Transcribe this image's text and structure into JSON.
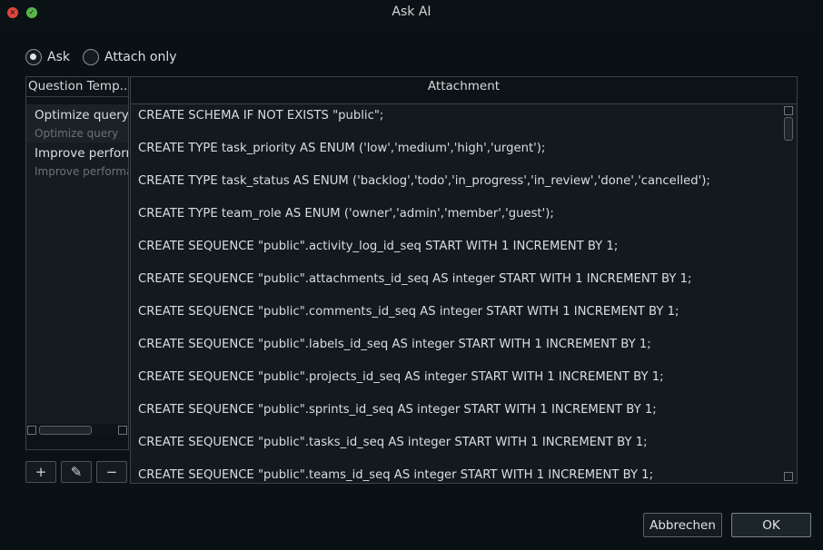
{
  "window": {
    "title": "Ask AI",
    "close_glyph": "×",
    "ok_glyph": "✓"
  },
  "mode": {
    "options": [
      {
        "label": "Ask",
        "checked": true
      },
      {
        "label": "Attach only",
        "checked": false
      }
    ]
  },
  "templates": {
    "header": "Question Temp...",
    "items": [
      {
        "title": "Optimize query",
        "subtitle": "Optimize query",
        "selected": true
      },
      {
        "title": "Improve performance",
        "subtitle": "Improve performance",
        "selected": false
      }
    ],
    "buttons": {
      "add": "+",
      "edit": "✎",
      "remove": "−"
    }
  },
  "attachment": {
    "header": "Attachment",
    "lines": [
      "CREATE SCHEMA IF NOT EXISTS \"public\";",
      "CREATE TYPE task_priority AS ENUM ('low','medium','high','urgent');",
      "CREATE TYPE task_status AS ENUM ('backlog','todo','in_progress','in_review','done','cancelled');",
      "CREATE TYPE team_role AS ENUM ('owner','admin','member','guest');",
      "CREATE SEQUENCE \"public\".activity_log_id_seq START WITH 1 INCREMENT BY 1;",
      "CREATE SEQUENCE \"public\".attachments_id_seq AS integer START WITH 1 INCREMENT BY 1;",
      "CREATE SEQUENCE \"public\".comments_id_seq AS integer START WITH 1 INCREMENT BY 1;",
      "CREATE SEQUENCE \"public\".labels_id_seq AS integer START WITH 1 INCREMENT BY 1;",
      "CREATE SEQUENCE \"public\".projects_id_seq AS integer START WITH 1 INCREMENT BY 1;",
      "CREATE SEQUENCE \"public\".sprints_id_seq AS integer START WITH 1 INCREMENT BY 1;",
      "CREATE SEQUENCE \"public\".tasks_id_seq AS integer START WITH 1 INCREMENT BY 1;",
      "CREATE SEQUENCE \"public\".teams_id_seq AS integer START WITH 1 INCREMENT BY 1;"
    ]
  },
  "footer": {
    "cancel_label": "Abbrechen",
    "ok_label": "OK"
  }
}
